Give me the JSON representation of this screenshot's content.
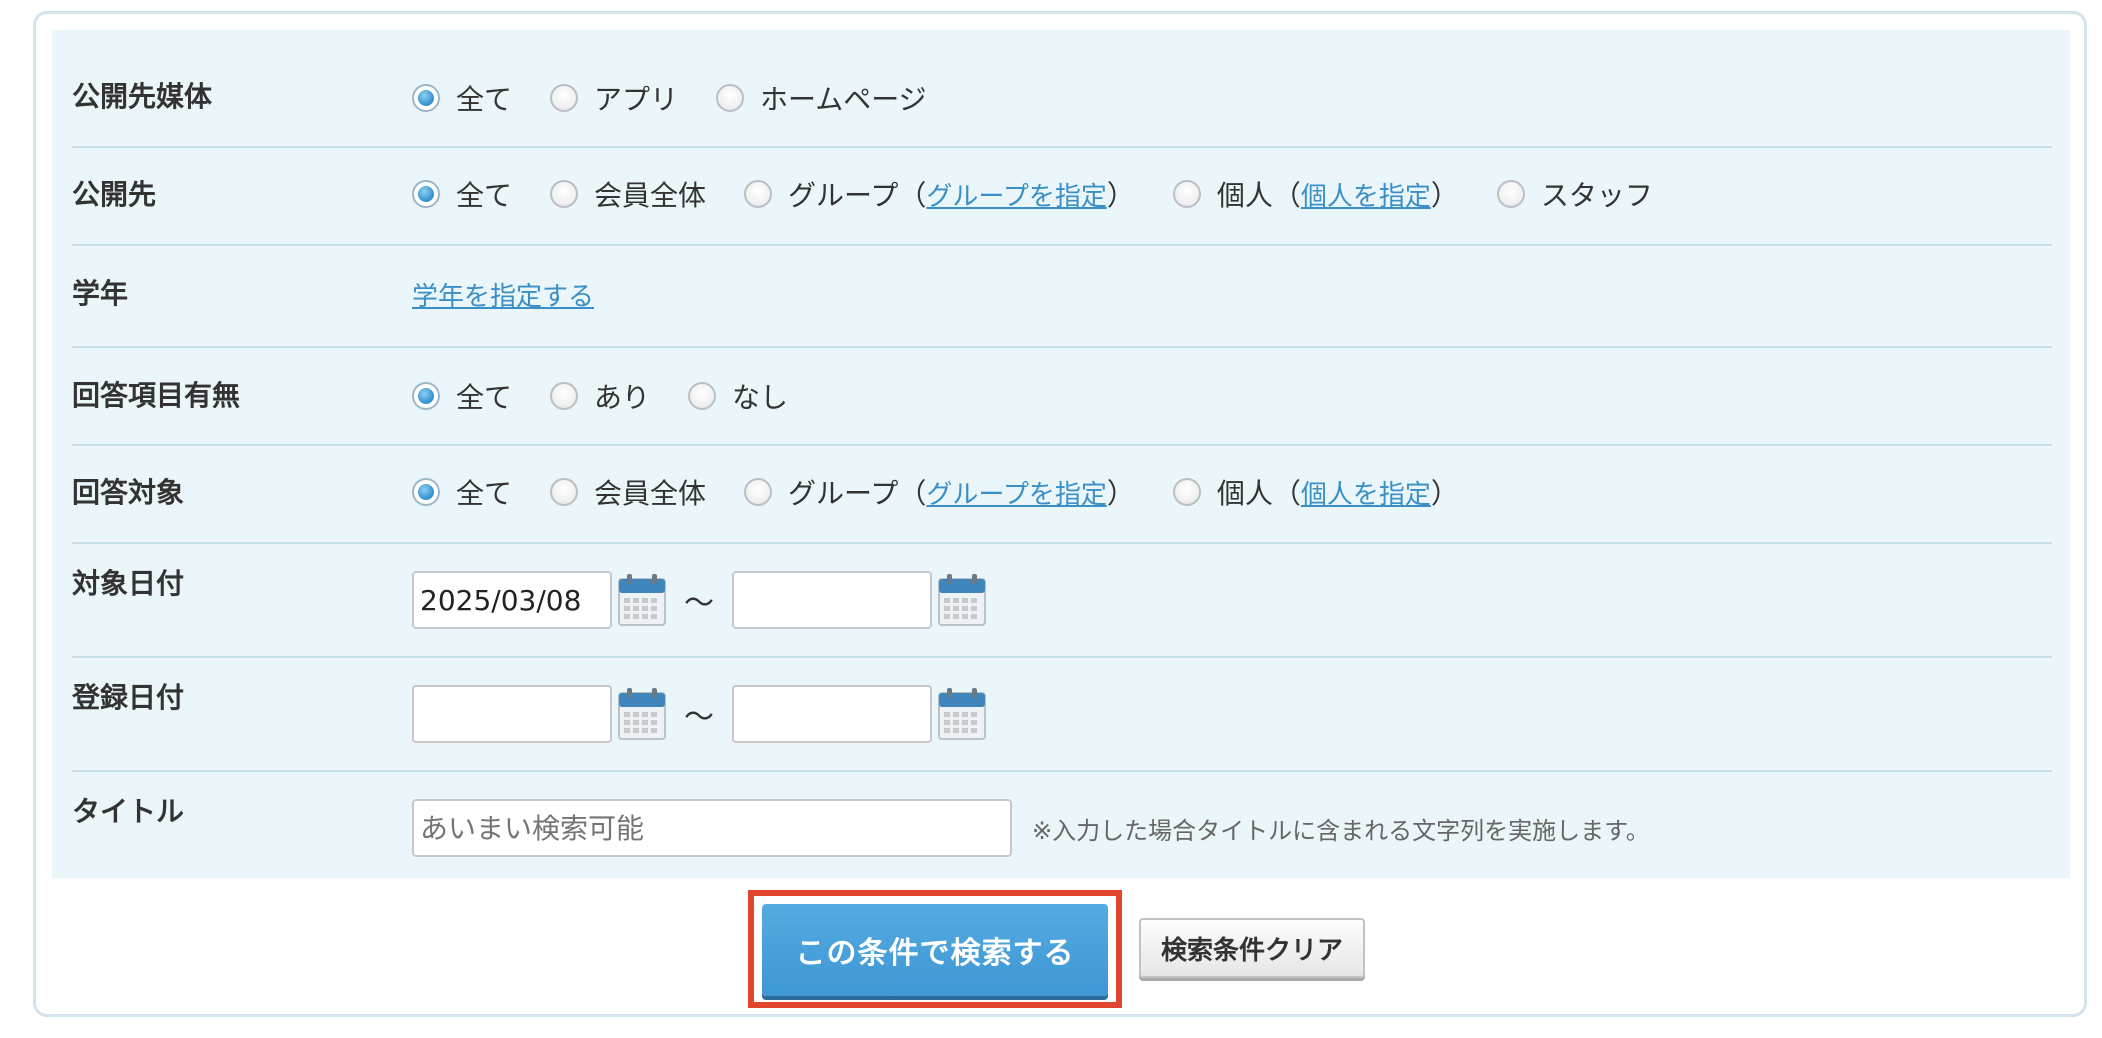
{
  "rows": {
    "media": {
      "label": "公開先媒体",
      "options": [
        "全て",
        "アプリ",
        "ホームページ"
      ]
    },
    "audience": {
      "label": "公開先",
      "options": [
        "全て",
        "会員全体",
        "グループ",
        "個人",
        "スタッフ"
      ],
      "group_link": "グループを指定",
      "individual_link": "個人を指定"
    },
    "grade": {
      "label": "学年",
      "link": "学年を指定する"
    },
    "answer_items": {
      "label": "回答項目有無",
      "options": [
        "全て",
        "あり",
        "なし"
      ]
    },
    "answer_target": {
      "label": "回答対象",
      "options": [
        "全て",
        "会員全体",
        "グループ",
        "個人"
      ],
      "group_link": "グループを指定",
      "individual_link": "個人を指定"
    },
    "target_date": {
      "label": "対象日付",
      "from_value": "2025/03/08",
      "to_value": "",
      "separator": "〜"
    },
    "registered_date": {
      "label": "登録日付",
      "from_value": "",
      "to_value": "",
      "separator": "〜"
    },
    "title": {
      "label": "タイトル",
      "placeholder": "あいまい検索可能",
      "note": "※入力した場合タイトルに含まれる文字列を実施します。"
    }
  },
  "paren_open": "（",
  "paren_close": "）",
  "buttons": {
    "search": "この条件で検索する",
    "clear": "検索条件クリア"
  },
  "selected": {
    "media": "全て",
    "audience": "全て",
    "answer_items": "全て",
    "answer_target": "全て"
  },
  "colors": {
    "accent": "#3e96d4",
    "link": "#3a8fc7",
    "highlight_border": "#e0462d",
    "panel_bg": "#eaf6f9"
  }
}
